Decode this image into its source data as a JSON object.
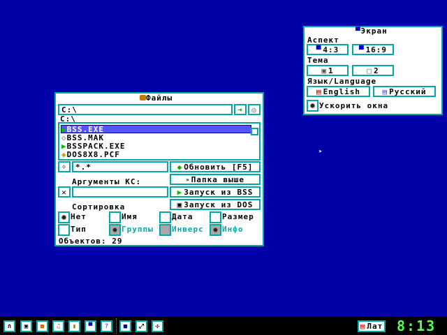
{
  "files": {
    "title": "Файлы",
    "path_value": "C:\\",
    "current_dir": "C:\\",
    "items": [
      {
        "name": "BSS.EXE",
        "icon": "exe-icon",
        "selected": true
      },
      {
        "name": "BSS.MAK",
        "icon": "file-icon",
        "selected": false
      },
      {
        "name": "BSSPACK.EXE",
        "icon": "exe-icon",
        "selected": false
      },
      {
        "name": "DOS8X8.PCF",
        "icon": "font-icon",
        "selected": false
      }
    ],
    "mask_value": "*.*",
    "args_label": "Аргументы КС:",
    "args_value": "",
    "refresh_label": "Обновить [F5]",
    "up_label": "Папка выше",
    "run_bss_label": "Запуск из BSS",
    "run_dos_label": "Запуск из DOS",
    "sort_label": "Сортировка",
    "sort_options": [
      {
        "label": "Нет",
        "checked": true
      },
      {
        "label": "Имя",
        "checked": false
      },
      {
        "label": "Дата",
        "checked": false
      },
      {
        "label": "Размер",
        "checked": false
      },
      {
        "label": "Тип",
        "checked": false
      },
      {
        "label": "Группы",
        "checked": true
      },
      {
        "label": "Инверс",
        "checked": false
      },
      {
        "label": "Инфо",
        "checked": true
      }
    ],
    "objects_label": "Объектов: 29"
  },
  "screen": {
    "title": "Экран",
    "aspect_label": "Аспект",
    "aspect_options": [
      "4:3",
      "16:9"
    ],
    "theme_label": "Тема",
    "theme_options": [
      "1",
      "2"
    ],
    "language_label": "Язык/Language",
    "language_options": [
      "English",
      "Русский"
    ],
    "speedup_label": "Ускорить окна",
    "speedup_checked": true
  },
  "taskbar": {
    "layout_label": "Лат",
    "clock": "8:13",
    "colors": {
      "clock": "#55ff55",
      "accent": "#00a8a8"
    }
  }
}
